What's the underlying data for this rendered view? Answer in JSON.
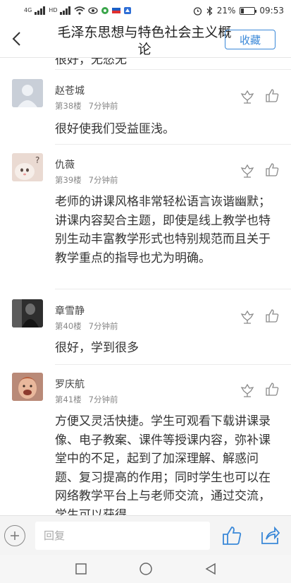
{
  "status_bar": {
    "signal_tag_1": "4G",
    "signal_tag_2": "HD",
    "battery_text": "21%",
    "battery_level": 0.21,
    "time": "09:53"
  },
  "header": {
    "title": "毛泽东思想与特色社会主义概论",
    "collect_label": "收藏"
  },
  "truncated_text": "很好，无愁无",
  "comments": [
    {
      "user": "赵苍城",
      "floor": "第38楼",
      "time": "7分钟前",
      "text": "很好使我们受益匪浅。"
    },
    {
      "user": "仇薇",
      "floor": "第39楼",
      "time": "7分钟前",
      "text": "老师的讲课风格非常轻松语言诙谐幽默；讲课内容契合主题，即使是线上教学也特别生动丰富教学形式也特别规范而且关于教学重点的指导也尤为明确。"
    },
    {
      "user": "章雪静",
      "floor": "第40楼",
      "time": "7分钟前",
      "text": "很好，学到很多"
    },
    {
      "user": "罗庆航",
      "floor": "第41楼",
      "time": "7分钟前",
      "text": "方便又灵活快捷。学生可观看下载讲课录像、电子教案、课件等授课内容，弥补课堂中的不足，起到了加深理解、解惑问题、复习提高的作用；同时学生也可以在网络教学平台上与老师交流，通过交流，学生可以获得"
    }
  ],
  "reply": {
    "placeholder": "回复"
  },
  "icons": {
    "back": "chevron-left-icon",
    "flower": "flower-icon",
    "thumb": "thumbs-up-icon",
    "share": "share-icon",
    "plus": "plus-icon"
  }
}
